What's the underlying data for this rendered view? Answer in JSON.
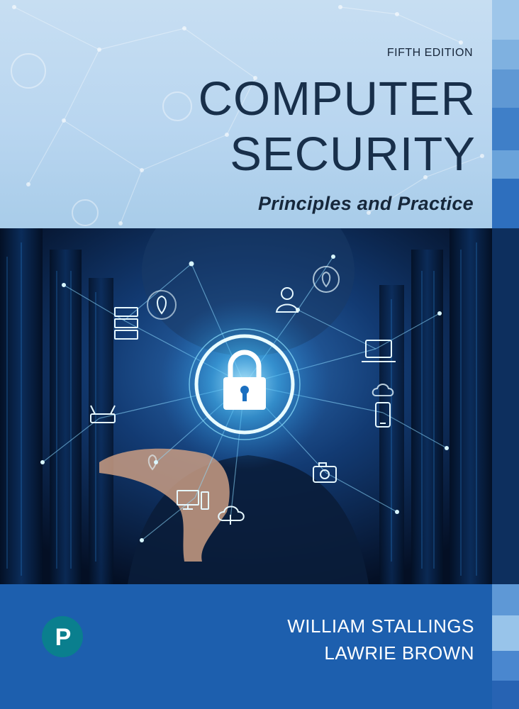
{
  "cover": {
    "edition": "FIFTH EDITION",
    "title_line_1": "COMPUTER",
    "title_line_2": "SECURITY",
    "subtitle": "Principles and Practice",
    "authors": [
      "WILLIAM STALLINGS",
      "LAWRIE BROWN"
    ],
    "publisher_logo_letter": "P",
    "icons": [
      "padlock-icon",
      "user-icon",
      "location-pin-icon",
      "server-icon",
      "router-icon",
      "laptop-icon",
      "cloud-icon",
      "phone-icon",
      "camera-icon",
      "desktop-icon",
      "cloud-sync-icon"
    ],
    "colors": {
      "title_band": "#c0daf1",
      "title_text": "#182f4a",
      "author_band": "#1d5fae",
      "author_text": "#ffffff",
      "logo": "#0a7f8e",
      "glow": "#7fd8ff"
    }
  }
}
